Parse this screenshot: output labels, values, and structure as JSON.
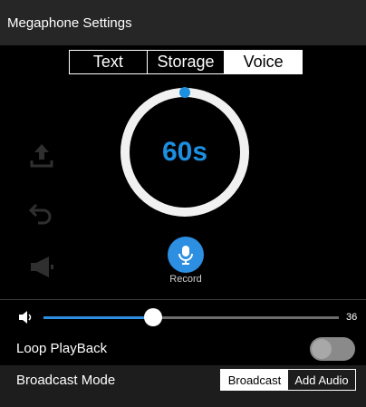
{
  "window": {
    "title": "Megaphone Settings"
  },
  "tabs": [
    {
      "label": "Text",
      "active": false
    },
    {
      "label": "Storage",
      "active": false
    },
    {
      "label": "Voice",
      "active": true
    }
  ],
  "side_icons": [
    "upload-icon",
    "undo-icon",
    "megaphone-icon"
  ],
  "dial": {
    "time": "60s"
  },
  "record": {
    "label": "Record",
    "icon": "microphone-icon"
  },
  "volume": {
    "icon": "speaker-icon",
    "value": 36,
    "max": 100,
    "display": "36"
  },
  "loop": {
    "label": "Loop PlayBack",
    "enabled": false
  },
  "broadcast": {
    "label": "Broadcast Mode",
    "options": [
      {
        "label": "Broadcast",
        "active": true
      },
      {
        "label": "Add Audio",
        "active": false
      }
    ]
  },
  "colors": {
    "accent": "#2d8fe1",
    "titlebar": "#262626",
    "background": "#000000"
  }
}
